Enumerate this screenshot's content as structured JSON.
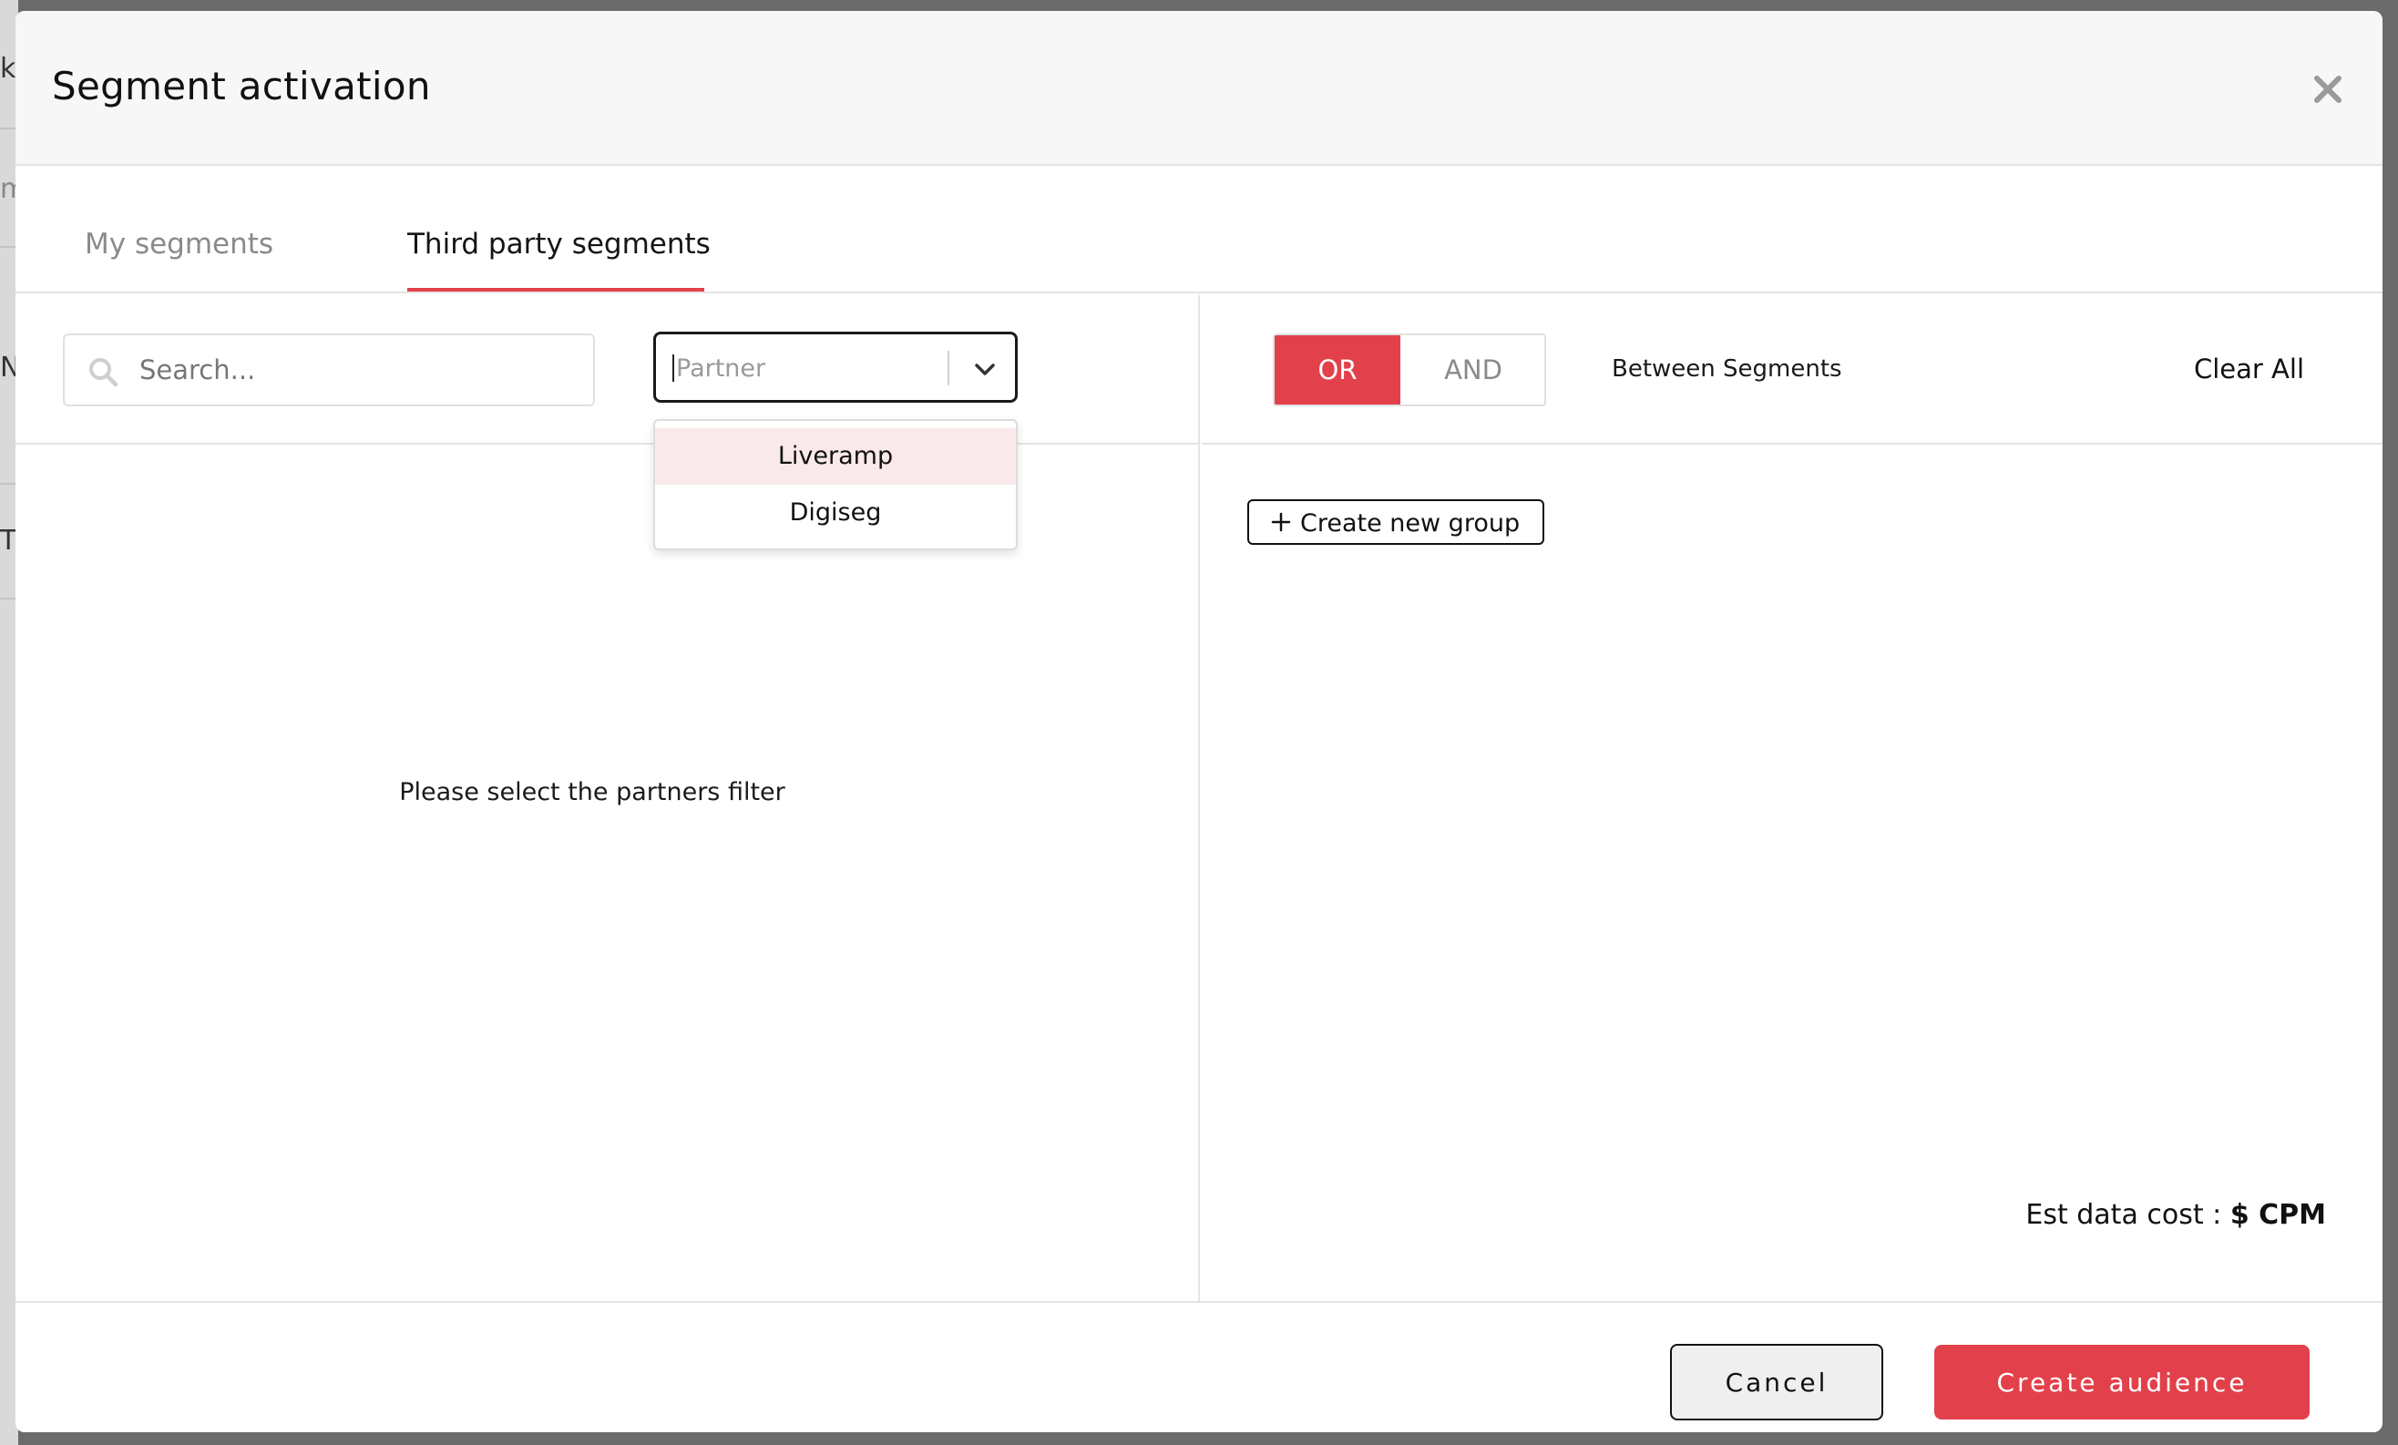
{
  "backdrop": {
    "glyphs": [
      "k",
      "m",
      "N",
      "T"
    ]
  },
  "modal": {
    "title": "Segment activation",
    "close_icon": "close-icon"
  },
  "tabs": [
    {
      "label": "My segments",
      "active": false
    },
    {
      "label": "Third party segments",
      "active": true
    }
  ],
  "left": {
    "search": {
      "placeholder": "Search...",
      "value": "",
      "icon": "search-icon"
    },
    "partner_select": {
      "placeholder": "Partner",
      "icon": "chevron-down-icon",
      "options": [
        "Liveramp",
        "Digiseg"
      ]
    },
    "empty_message": "Please select the partners filter"
  },
  "right": {
    "logic_toggle": {
      "or_label": "OR",
      "and_label": "AND",
      "selected": "OR"
    },
    "between_label": "Between Segments",
    "clear_all_label": "Clear All",
    "create_group_label": "Create new group",
    "est_cost_label": "Est data cost :",
    "est_cost_value": "$ CPM"
  },
  "footer": {
    "cancel_label": "Cancel",
    "create_label": "Create audience"
  },
  "colors": {
    "accent": "#e2414b",
    "hover_option": "#fae9ea",
    "header_bg": "#f7f7f7",
    "overlay": "#6b6b6b"
  }
}
